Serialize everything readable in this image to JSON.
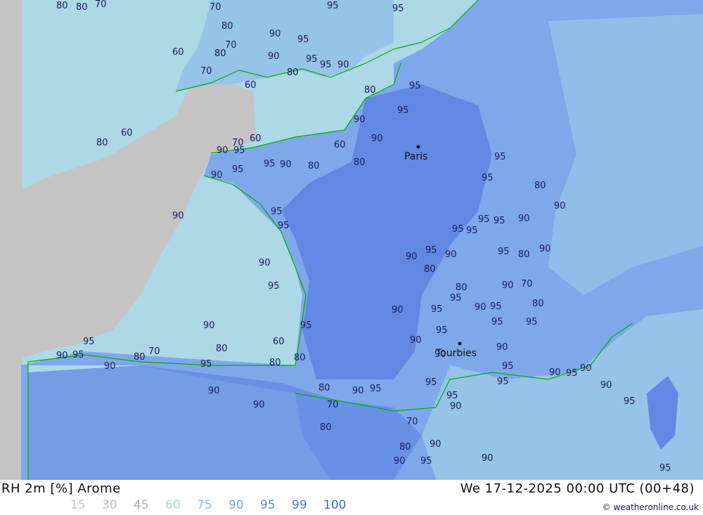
{
  "map": {
    "colors": {
      "no_data": "#c4c4c4",
      "rh60": "#add8e6",
      "rh75": "#96c3e8",
      "rh90": "#7ea8ea",
      "rh95": "#6189e4",
      "coast": "#00b000"
    },
    "cities": [
      {
        "name": "Paris"
      },
      {
        "name": "Tourbies"
      }
    ],
    "contour_labels": [
      "80",
      "80",
      "70",
      "70",
      "95",
      "95",
      "90",
      "80",
      "60",
      "70",
      "80",
      "95",
      "90",
      "95",
      "95",
      "90",
      "80",
      "60",
      "70",
      "80",
      "95",
      "95",
      "90",
      "60",
      "80",
      "70",
      "60",
      "90",
      "95",
      "95",
      "90",
      "95",
      "90",
      "80",
      "60",
      "80",
      "90",
      "95",
      "95",
      "80",
      "90",
      "95",
      "95",
      "90",
      "90",
      "95",
      "90",
      "80",
      "60",
      "80",
      "80",
      "95",
      "90",
      "95",
      "95",
      "95",
      "95",
      "95",
      "90",
      "90",
      "95",
      "90",
      "80",
      "95",
      "80",
      "90",
      "80",
      "95",
      "90",
      "95",
      "90",
      "70",
      "80",
      "95",
      "95",
      "90",
      "90",
      "95",
      "90",
      "95",
      "90",
      "95",
      "95",
      "90",
      "90",
      "95",
      "95",
      "95",
      "90",
      "70",
      "80",
      "90",
      "90",
      "95",
      "90",
      "95",
      "90",
      "80",
      "70",
      "80",
      "90",
      "90",
      "95",
      "95",
      "90",
      "95",
      "90",
      "80",
      "70",
      "95"
    ]
  },
  "footer": {
    "left_title": "RH 2m [%] Arome",
    "right_title": "We 17-12-2025 00:00 UTC (00+48)",
    "legend": [
      {
        "label": "15",
        "color": "#c8c8c8"
      },
      {
        "label": "30",
        "color": "#bdbdbd"
      },
      {
        "label": "45",
        "color": "#b0b0b0"
      },
      {
        "label": "60",
        "color": "#a8d4e4"
      },
      {
        "label": "75",
        "color": "#8fbbe0"
      },
      {
        "label": "90",
        "color": "#7aa4e6"
      },
      {
        "label": "95",
        "color": "#5f8ae6"
      },
      {
        "label": "99",
        "color": "#4f78e6"
      },
      {
        "label": "100",
        "color": "#3d66e8"
      }
    ],
    "credit": "© weatheronline.co.uk"
  }
}
